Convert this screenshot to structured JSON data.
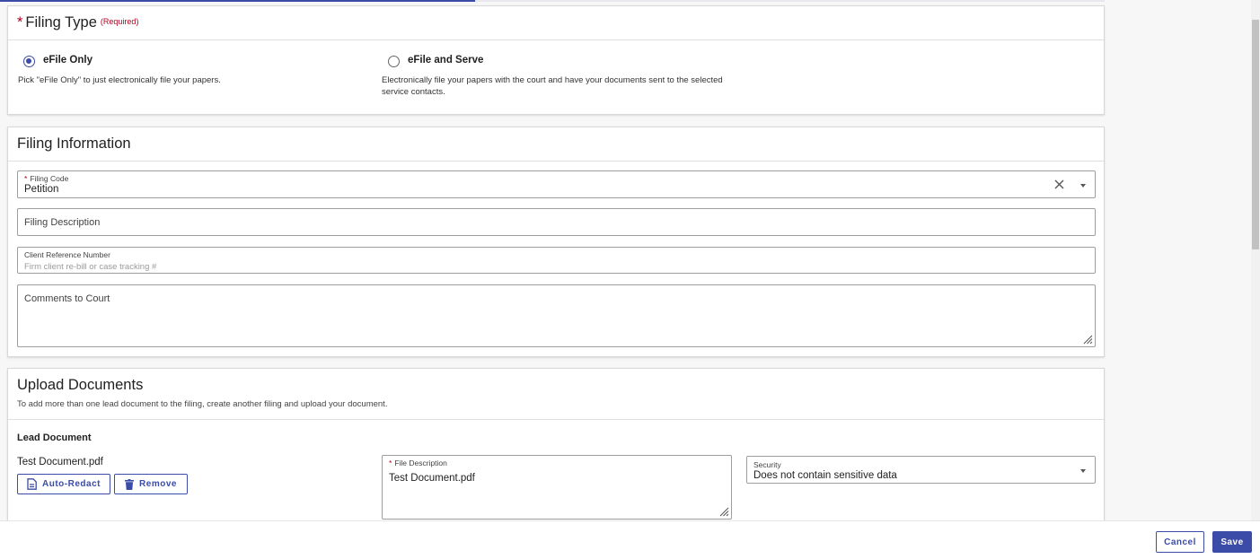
{
  "progress": {
    "fraction": 0.43
  },
  "filing_type": {
    "title": "Filing Type",
    "required_marker": "*",
    "required_note": "(Required)",
    "options": [
      {
        "label": "eFile Only",
        "selected": true,
        "help": "Pick \"eFile Only\" to just electronically file your papers."
      },
      {
        "label": "eFile and Serve",
        "selected": false,
        "help_line1": "Electronically file your papers with the court and have your documents sent to the selected",
        "help_line2": "service contacts."
      }
    ]
  },
  "filing_info": {
    "title": "Filing Information",
    "filing_code": {
      "required_marker": "*",
      "label": "Filing Code",
      "value": "Petition",
      "clear_icon": "close-icon",
      "dropdown_icon": "caret-down-icon"
    },
    "filing_description": {
      "placeholder": "Filing Description",
      "value": ""
    },
    "client_reference": {
      "label": "Client Reference Number",
      "placeholder": "Firm client re-bill or case tracking #",
      "value": ""
    },
    "comments": {
      "placeholder": "Comments to Court",
      "value": ""
    }
  },
  "upload": {
    "title": "Upload Documents",
    "description": "To add more than one lead document to the filing, create another filing and upload your document.",
    "lead_label": "Lead Document",
    "document": {
      "file_name": "Test Document.pdf",
      "auto_redact_label": "Auto-Redact",
      "remove_label": "Remove",
      "file_description": {
        "required_marker": "*",
        "label": "File Description",
        "value": "Test Document.pdf"
      },
      "security": {
        "label": "Security",
        "value": "Does not contain sensitive data"
      }
    }
  },
  "footer": {
    "cancel_label": "Cancel",
    "save_label": "Save"
  },
  "colors": {
    "accent": "#3b4ba8",
    "required": "#b00020"
  }
}
